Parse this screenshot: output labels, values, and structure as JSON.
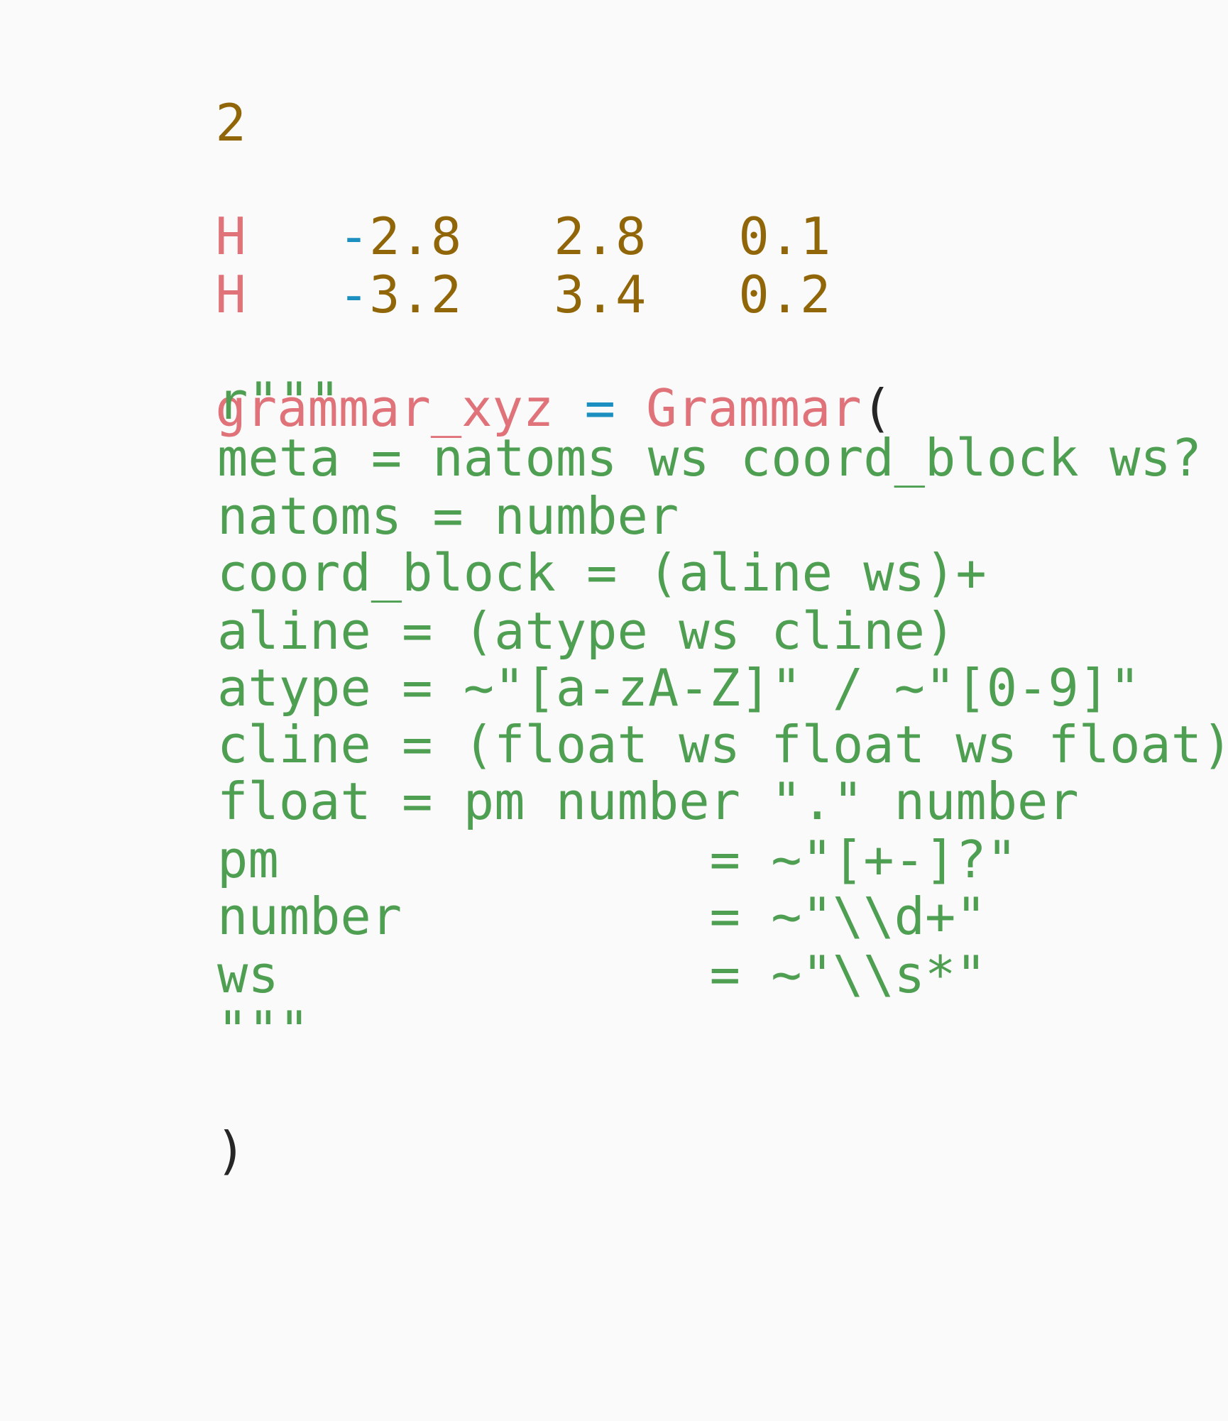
{
  "code": {
    "count": "2",
    "rows": [
      {
        "atom": "H",
        "x_sign": "-",
        "x": "2.8",
        "y": "2.8",
        "z": "0.1"
      },
      {
        "atom": "H",
        "x_sign": "-",
        "x": "3.2",
        "y": "3.4",
        "z": "0.2"
      }
    ],
    "assign": {
      "name": "grammar_xyz",
      "op": "=",
      "call": "Grammar",
      "open": "(",
      "close": ")"
    },
    "grammar_lines": [
      "r\"\"\"",
      "meta = natoms ws coord_block ws?",
      "natoms = number",
      "coord_block = (aline ws)+",
      "aline = (atype ws cline)",
      "atype = ~\"[a-zA-Z]\" / ~\"[0-9]\"",
      "cline = (float ws float ws float)",
      "float = pm number \".\" number",
      "pm              = ~\"[+-]?\"",
      "number          = ~\"\\\\d+\"",
      "ws              = ~\"\\\\s*\"",
      "\"\"\""
    ]
  }
}
